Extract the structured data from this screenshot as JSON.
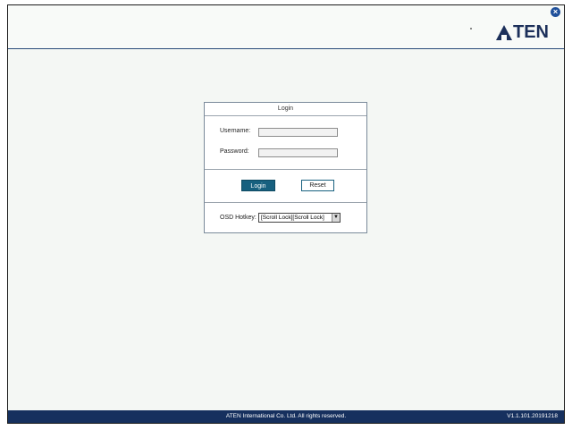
{
  "header": {
    "close_icon": "×",
    "logo_text": "TEN",
    "logo_full": "ATEN"
  },
  "login_panel": {
    "title": "Login",
    "username_label": "Username:",
    "username_value": "",
    "password_label": "Password:",
    "password_value": "",
    "login_button": "Login",
    "reset_button": "Reset",
    "hotkey_label": "OSD Hotkey:",
    "hotkey_value": "[Scroll Lock][Scroll Lock]",
    "hotkey_arrow": "▼"
  },
  "footer": {
    "copyright": "ATEN International Co. Ltd. All rights reserved.",
    "version": "V1.1.101.20191218"
  },
  "colors": {
    "brand_navy": "#1c2f5a",
    "footer_bg": "#16305e",
    "login_button_bg": "#17607f"
  }
}
